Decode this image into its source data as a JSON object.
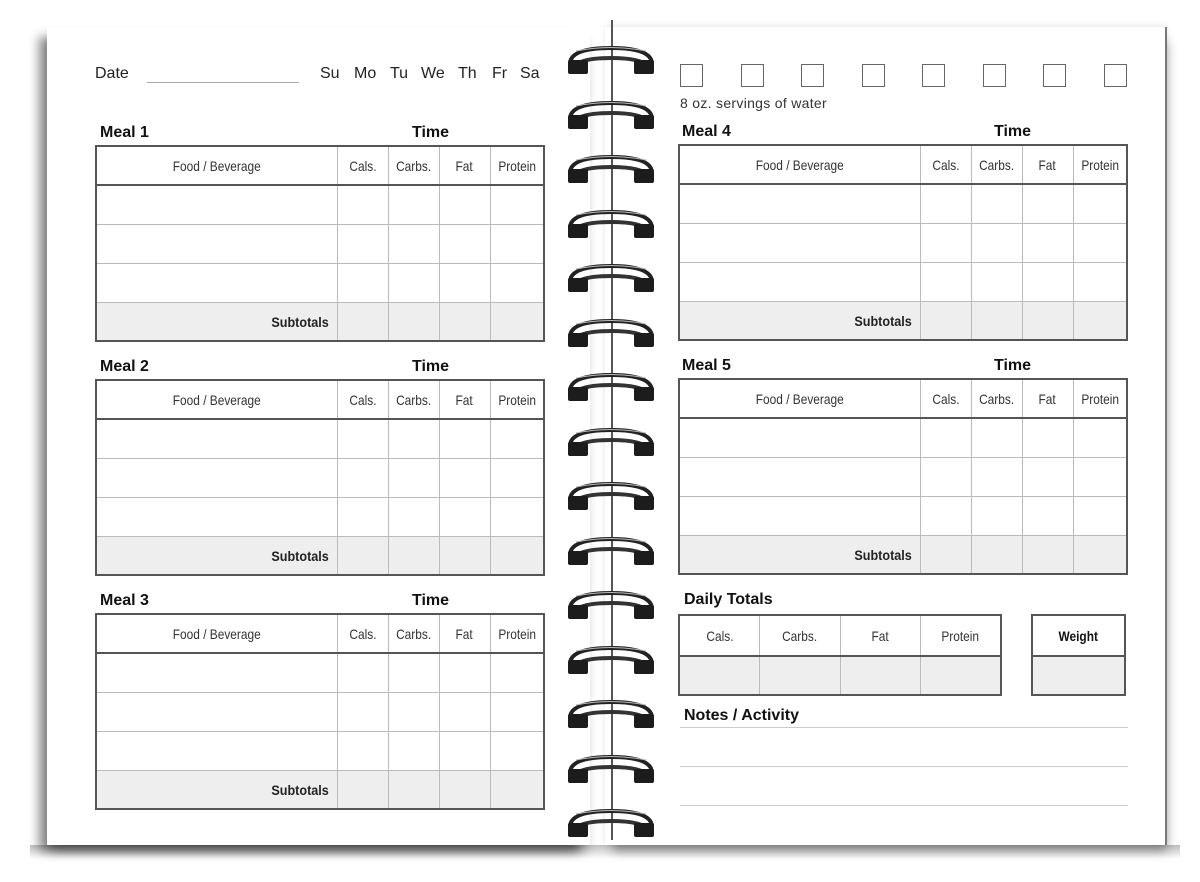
{
  "header": {
    "date_label": "Date",
    "date_value": "",
    "days": [
      "Su",
      "Mo",
      "Tu",
      "We",
      "Th",
      "Fr",
      "Sa"
    ]
  },
  "water": {
    "box_count": 8,
    "checked": [
      false,
      false,
      false,
      false,
      false,
      false,
      false,
      false
    ],
    "label": "8 oz. servings of water"
  },
  "columns": {
    "food": "Food / Beverage",
    "cals": "Cals.",
    "carbs": "Carbs.",
    "fat": "Fat",
    "protein": "Protein"
  },
  "time_label": "Time",
  "subtotals_label": "Subtotals",
  "meals": [
    {
      "title": "Meal 1",
      "time": "",
      "rows": [
        [
          "",
          "",
          "",
          "",
          ""
        ],
        [
          "",
          "",
          "",
          "",
          ""
        ],
        [
          "",
          "",
          "",
          "",
          ""
        ]
      ],
      "subtotals": [
        "",
        "",
        "",
        ""
      ]
    },
    {
      "title": "Meal 2",
      "time": "",
      "rows": [
        [
          "",
          "",
          "",
          "",
          ""
        ],
        [
          "",
          "",
          "",
          "",
          ""
        ],
        [
          "",
          "",
          "",
          "",
          ""
        ]
      ],
      "subtotals": [
        "",
        "",
        "",
        ""
      ]
    },
    {
      "title": "Meal 3",
      "time": "",
      "rows": [
        [
          "",
          "",
          "",
          "",
          ""
        ],
        [
          "",
          "",
          "",
          "",
          ""
        ],
        [
          "",
          "",
          "",
          "",
          ""
        ]
      ],
      "subtotals": [
        "",
        "",
        "",
        ""
      ]
    },
    {
      "title": "Meal 4",
      "time": "",
      "rows": [
        [
          "",
          "",
          "",
          "",
          ""
        ],
        [
          "",
          "",
          "",
          "",
          ""
        ],
        [
          "",
          "",
          "",
          "",
          ""
        ]
      ],
      "subtotals": [
        "",
        "",
        "",
        ""
      ]
    },
    {
      "title": "Meal 5",
      "time": "",
      "rows": [
        [
          "",
          "",
          "",
          "",
          ""
        ],
        [
          "",
          "",
          "",
          "",
          ""
        ],
        [
          "",
          "",
          "",
          "",
          ""
        ]
      ],
      "subtotals": [
        "",
        "",
        "",
        ""
      ]
    }
  ],
  "daily_totals": {
    "title": "Daily Totals",
    "headers": [
      "Cals.",
      "Carbs.",
      "Fat",
      "Protein"
    ],
    "values": [
      "",
      "",
      "",
      ""
    ]
  },
  "weight": {
    "label": "Weight",
    "value": ""
  },
  "notes": {
    "title": "Notes / Activity",
    "lines": [
      "",
      "",
      ""
    ]
  }
}
